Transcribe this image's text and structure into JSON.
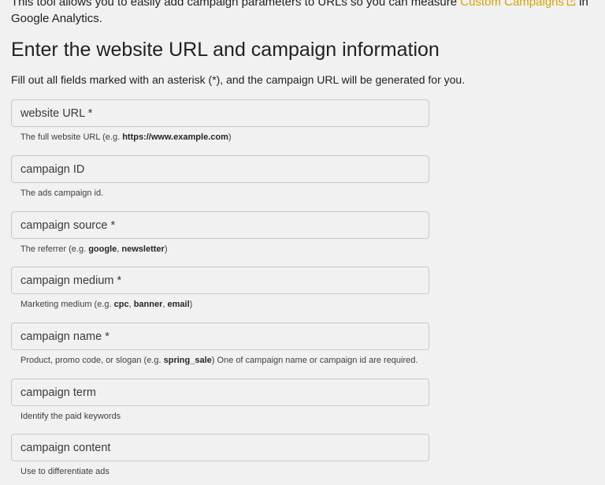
{
  "intro": {
    "text_before": "This tool allows you to easily add campaign parameters to URLs so you can measure ",
    "link_text": "Custom Campaigns",
    "text_after": " in Google Analytics."
  },
  "heading": "Enter the website URL and campaign information",
  "subtitle": "Fill out all fields marked with an asterisk (*), and the campaign URL will be generated for you.",
  "colors": {
    "link": "#d7a300",
    "background": "#f1f1f1",
    "border": "#c9c9c9"
  },
  "fields": [
    {
      "label": "website URL *",
      "help": [
        [
          "The full website URL (e.g. ",
          false
        ],
        [
          "https://www.example.com",
          true
        ],
        [
          ")",
          false
        ]
      ]
    },
    {
      "label": "campaign ID",
      "help": [
        [
          "The ads campaign id.",
          false
        ]
      ]
    },
    {
      "label": "campaign source *",
      "help": [
        [
          "The referrer (e.g. ",
          false
        ],
        [
          "google",
          true
        ],
        [
          ", ",
          false
        ],
        [
          "newsletter",
          true
        ],
        [
          ")",
          false
        ]
      ]
    },
    {
      "label": "campaign medium *",
      "help": [
        [
          "Marketing medium (e.g. ",
          false
        ],
        [
          "cpc",
          true
        ],
        [
          ", ",
          false
        ],
        [
          "banner",
          true
        ],
        [
          ", ",
          false
        ],
        [
          "email",
          true
        ],
        [
          ")",
          false
        ]
      ]
    },
    {
      "label": "campaign name *",
      "help": [
        [
          "Product, promo code, or slogan (e.g. ",
          false
        ],
        [
          "spring_sale",
          true
        ],
        [
          ") One of campaign name or campaign id are required.",
          false
        ]
      ]
    },
    {
      "label": "campaign term",
      "help": [
        [
          "Identify the paid keywords",
          false
        ]
      ]
    },
    {
      "label": "campaign content",
      "help": [
        [
          "Use to differentiate ads",
          false
        ]
      ]
    }
  ]
}
